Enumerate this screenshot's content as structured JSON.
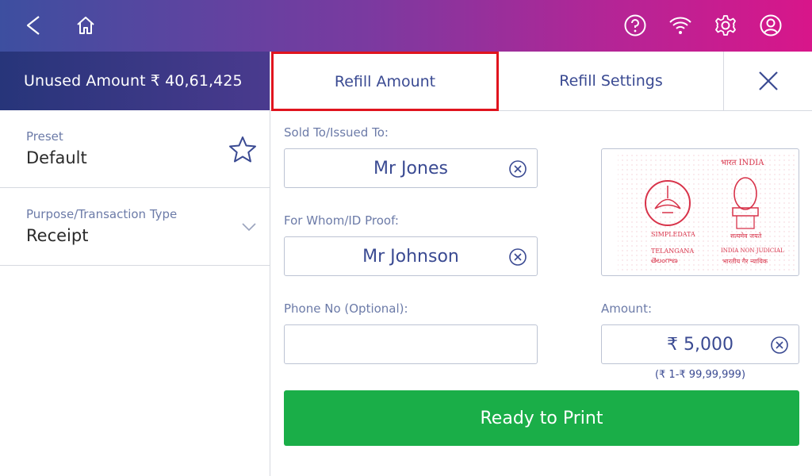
{
  "topbar": {
    "icons": [
      "back-icon",
      "home-icon",
      "help-icon",
      "wifi-icon",
      "settings-icon",
      "account-icon"
    ]
  },
  "sidebar": {
    "unused_amount": "Unused Amount ₹ 40,61,425",
    "preset": {
      "label": "Preset",
      "value": "Default"
    },
    "purpose": {
      "label": "Purpose/Transaction Type",
      "value": "Receipt"
    }
  },
  "tabs": {
    "refill_amount": "Refill Amount",
    "refill_settings": "Refill Settings"
  },
  "form": {
    "sold_to": {
      "label": "Sold To/Issued To:",
      "value": "Mr Jones"
    },
    "for_whom": {
      "label": "For Whom/ID Proof:",
      "value": "Mr Johnson"
    },
    "phone": {
      "label": "Phone No (Optional):",
      "value": ""
    },
    "amount": {
      "label": "Amount:",
      "value": "₹ 5,000",
      "range": "(₹ 1-₹ 99,99,999)"
    }
  },
  "stamp": {
    "top_text": "भारत INDIA",
    "left_line1": "SIMPLEDATA",
    "left_line2": "TELANGANA",
    "left_line3": "తెలంగాణ",
    "right_line1": "सत्यमेव जयते",
    "right_line2": "INDIA NON JUDICIAL",
    "right_line3": "भारतीय गैर न्यायिक"
  },
  "actions": {
    "print": "Ready to Print"
  },
  "colors": {
    "accent": "#3a4a92",
    "print_green": "#1aae48",
    "highlight_red": "#e0141e"
  }
}
